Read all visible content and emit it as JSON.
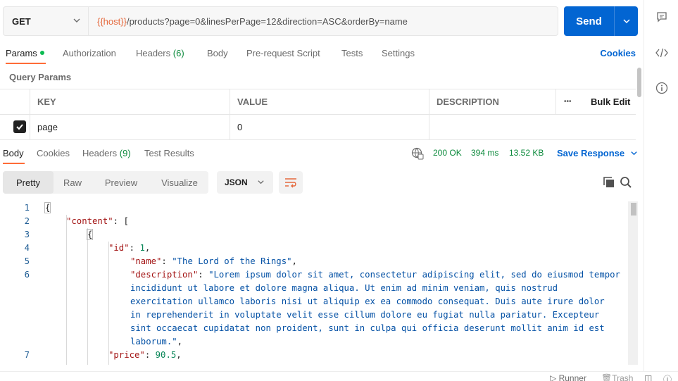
{
  "request": {
    "method": "GET",
    "url_var": "{{host}}",
    "url_path": "/products?page=0&linesPerPage=12&direction=ASC&orderBy=name",
    "send_label": "Send"
  },
  "request_tabs": {
    "params": "Params",
    "authorization": "Authorization",
    "headers": "Headers",
    "headers_count": "(6)",
    "body": "Body",
    "prerequest": "Pre-request Script",
    "tests": "Tests",
    "settings": "Settings",
    "cookies": "Cookies"
  },
  "query_params": {
    "title": "Query Params",
    "columns": {
      "key": "KEY",
      "value": "VALUE",
      "description": "DESCRIPTION",
      "more": "•••",
      "bulk_edit": "Bulk Edit"
    },
    "rows": [
      {
        "key": "page",
        "value": "0",
        "description": "",
        "checked": true
      }
    ]
  },
  "response_tabs": {
    "body": "Body",
    "cookies": "Cookies",
    "headers": "Headers",
    "headers_count": "(9)",
    "test_results": "Test Results"
  },
  "response_status": {
    "status": "200 OK",
    "time": "394 ms",
    "size": "13.52 KB",
    "save_response": "Save Response"
  },
  "view_modes": [
    "Pretty",
    "Raw",
    "Preview",
    "Visualize"
  ],
  "format": "JSON",
  "code_lines": [
    {
      "num": "1",
      "parts": [
        {
          "t": "{",
          "c": "p"
        }
      ]
    },
    {
      "num": "2",
      "parts": [
        {
          "t": "\"content\"",
          "c": "key"
        },
        {
          "t": ": [",
          "c": "p"
        }
      ]
    },
    {
      "num": "3",
      "parts": [
        {
          "t": "{",
          "c": "p"
        }
      ]
    },
    {
      "num": "4",
      "parts": [
        {
          "t": "\"id\"",
          "c": "key"
        },
        {
          "t": ": ",
          "c": "p"
        },
        {
          "t": "1",
          "c": "num"
        },
        {
          "t": ",",
          "c": "p"
        }
      ]
    },
    {
      "num": "5",
      "parts": [
        {
          "t": "\"name\"",
          "c": "key"
        },
        {
          "t": ": ",
          "c": "p"
        },
        {
          "t": "\"The Lord of the Rings\"",
          "c": "str"
        },
        {
          "t": ",",
          "c": "p"
        }
      ]
    },
    {
      "num": "6",
      "parts": [
        {
          "t": "\"description\"",
          "c": "key"
        },
        {
          "t": ": ",
          "c": "p"
        },
        {
          "t": "\"Lorem ipsum dolor sit amet, consectetur adipiscing elit, sed do eiusmod tempor",
          "c": "str"
        }
      ]
    },
    {
      "num": "",
      "parts": [
        {
          "t": "incididunt ut labore et dolore magna aliqua. Ut enim ad minim veniam, quis nostrud",
          "c": "str"
        }
      ]
    },
    {
      "num": "",
      "parts": [
        {
          "t": "exercitation ullamco laboris nisi ut aliquip ex ea commodo consequat. Duis aute irure dolor",
          "c": "str"
        }
      ]
    },
    {
      "num": "",
      "parts": [
        {
          "t": "in reprehenderit in voluptate velit esse cillum dolore eu fugiat nulla pariatur. Excepteur",
          "c": "str"
        }
      ]
    },
    {
      "num": "",
      "parts": [
        {
          "t": "sint occaecat cupidatat non proident, sunt in culpa qui officia deserunt mollit anim id est",
          "c": "str"
        }
      ]
    },
    {
      "num": "",
      "parts": [
        {
          "t": "laborum.\"",
          "c": "str"
        },
        {
          "t": ",",
          "c": "p"
        }
      ]
    },
    {
      "num": "7",
      "parts": [
        {
          "t": "\"price\"",
          "c": "key"
        },
        {
          "t": ": ",
          "c": "p"
        },
        {
          "t": "90.5",
          "c": "num"
        },
        {
          "t": ",",
          "c": "p"
        }
      ]
    }
  ],
  "statusbar": {
    "runner": "Runner",
    "trash": "Trash"
  }
}
